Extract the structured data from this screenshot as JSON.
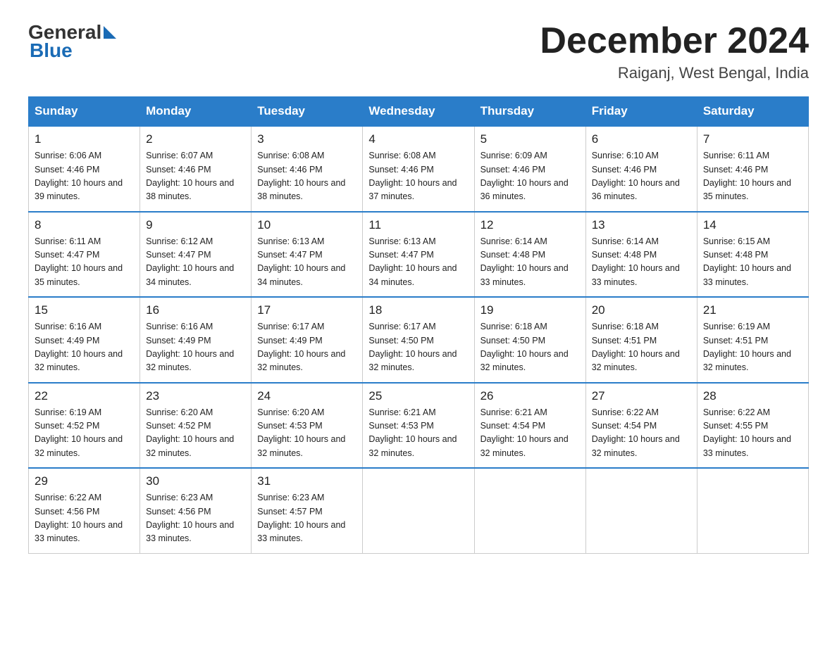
{
  "header": {
    "logo_general": "General",
    "logo_blue": "Blue",
    "month_title": "December 2024",
    "subtitle": "Raiganj, West Bengal, India"
  },
  "days_of_week": [
    "Sunday",
    "Monday",
    "Tuesday",
    "Wednesday",
    "Thursday",
    "Friday",
    "Saturday"
  ],
  "weeks": [
    [
      {
        "day": "1",
        "sunrise": "6:06 AM",
        "sunset": "4:46 PM",
        "daylight": "10 hours and 39 minutes."
      },
      {
        "day": "2",
        "sunrise": "6:07 AM",
        "sunset": "4:46 PM",
        "daylight": "10 hours and 38 minutes."
      },
      {
        "day": "3",
        "sunrise": "6:08 AM",
        "sunset": "4:46 PM",
        "daylight": "10 hours and 38 minutes."
      },
      {
        "day": "4",
        "sunrise": "6:08 AM",
        "sunset": "4:46 PM",
        "daylight": "10 hours and 37 minutes."
      },
      {
        "day": "5",
        "sunrise": "6:09 AM",
        "sunset": "4:46 PM",
        "daylight": "10 hours and 36 minutes."
      },
      {
        "day": "6",
        "sunrise": "6:10 AM",
        "sunset": "4:46 PM",
        "daylight": "10 hours and 36 minutes."
      },
      {
        "day": "7",
        "sunrise": "6:11 AM",
        "sunset": "4:46 PM",
        "daylight": "10 hours and 35 minutes."
      }
    ],
    [
      {
        "day": "8",
        "sunrise": "6:11 AM",
        "sunset": "4:47 PM",
        "daylight": "10 hours and 35 minutes."
      },
      {
        "day": "9",
        "sunrise": "6:12 AM",
        "sunset": "4:47 PM",
        "daylight": "10 hours and 34 minutes."
      },
      {
        "day": "10",
        "sunrise": "6:13 AM",
        "sunset": "4:47 PM",
        "daylight": "10 hours and 34 minutes."
      },
      {
        "day": "11",
        "sunrise": "6:13 AM",
        "sunset": "4:47 PM",
        "daylight": "10 hours and 34 minutes."
      },
      {
        "day": "12",
        "sunrise": "6:14 AM",
        "sunset": "4:48 PM",
        "daylight": "10 hours and 33 minutes."
      },
      {
        "day": "13",
        "sunrise": "6:14 AM",
        "sunset": "4:48 PM",
        "daylight": "10 hours and 33 minutes."
      },
      {
        "day": "14",
        "sunrise": "6:15 AM",
        "sunset": "4:48 PM",
        "daylight": "10 hours and 33 minutes."
      }
    ],
    [
      {
        "day": "15",
        "sunrise": "6:16 AM",
        "sunset": "4:49 PM",
        "daylight": "10 hours and 32 minutes."
      },
      {
        "day": "16",
        "sunrise": "6:16 AM",
        "sunset": "4:49 PM",
        "daylight": "10 hours and 32 minutes."
      },
      {
        "day": "17",
        "sunrise": "6:17 AM",
        "sunset": "4:49 PM",
        "daylight": "10 hours and 32 minutes."
      },
      {
        "day": "18",
        "sunrise": "6:17 AM",
        "sunset": "4:50 PM",
        "daylight": "10 hours and 32 minutes."
      },
      {
        "day": "19",
        "sunrise": "6:18 AM",
        "sunset": "4:50 PM",
        "daylight": "10 hours and 32 minutes."
      },
      {
        "day": "20",
        "sunrise": "6:18 AM",
        "sunset": "4:51 PM",
        "daylight": "10 hours and 32 minutes."
      },
      {
        "day": "21",
        "sunrise": "6:19 AM",
        "sunset": "4:51 PM",
        "daylight": "10 hours and 32 minutes."
      }
    ],
    [
      {
        "day": "22",
        "sunrise": "6:19 AM",
        "sunset": "4:52 PM",
        "daylight": "10 hours and 32 minutes."
      },
      {
        "day": "23",
        "sunrise": "6:20 AM",
        "sunset": "4:52 PM",
        "daylight": "10 hours and 32 minutes."
      },
      {
        "day": "24",
        "sunrise": "6:20 AM",
        "sunset": "4:53 PM",
        "daylight": "10 hours and 32 minutes."
      },
      {
        "day": "25",
        "sunrise": "6:21 AM",
        "sunset": "4:53 PM",
        "daylight": "10 hours and 32 minutes."
      },
      {
        "day": "26",
        "sunrise": "6:21 AM",
        "sunset": "4:54 PM",
        "daylight": "10 hours and 32 minutes."
      },
      {
        "day": "27",
        "sunrise": "6:22 AM",
        "sunset": "4:54 PM",
        "daylight": "10 hours and 32 minutes."
      },
      {
        "day": "28",
        "sunrise": "6:22 AM",
        "sunset": "4:55 PM",
        "daylight": "10 hours and 33 minutes."
      }
    ],
    [
      {
        "day": "29",
        "sunrise": "6:22 AM",
        "sunset": "4:56 PM",
        "daylight": "10 hours and 33 minutes."
      },
      {
        "day": "30",
        "sunrise": "6:23 AM",
        "sunset": "4:56 PM",
        "daylight": "10 hours and 33 minutes."
      },
      {
        "day": "31",
        "sunrise": "6:23 AM",
        "sunset": "4:57 PM",
        "daylight": "10 hours and 33 minutes."
      },
      null,
      null,
      null,
      null
    ]
  ]
}
